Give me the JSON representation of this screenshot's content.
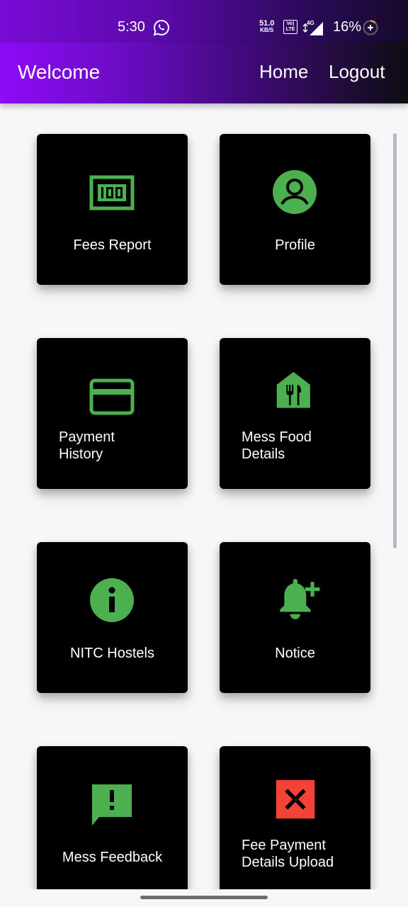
{
  "status_bar": {
    "time": "5:30",
    "speed_value": "51.0",
    "speed_unit": "KB/S",
    "volte_top": "Vo)",
    "volte_bottom": "LTE",
    "network_type": "4G",
    "battery": "16%",
    "icons": [
      "whatsapp-icon",
      "volte-icon",
      "signal-icon",
      "battery-saver-icon"
    ]
  },
  "app_bar": {
    "title": "Welcome",
    "home_label": "Home",
    "logout_label": "Logout",
    "gradient_colors": [
      "#8e0bf7",
      "#0d0d12"
    ]
  },
  "theme": {
    "card_bg": "#000000",
    "icon_green": "#4caf50",
    "icon_red": "#f44336",
    "page_bg": "#f7f7f9"
  },
  "cards": [
    {
      "label": "Fees Report",
      "icon": "money-icon"
    },
    {
      "label": "Profile",
      "icon": "account-circle-icon"
    },
    {
      "label": "Payment History",
      "icon": "credit-card-icon"
    },
    {
      "label": "Mess Food Details",
      "icon": "restaurant-house-icon"
    },
    {
      "label": "NITC Hostels",
      "icon": "info-icon"
    },
    {
      "label": "Notice",
      "icon": "notification-add-icon"
    },
    {
      "label": "Mess Feedback",
      "icon": "feedback-icon"
    },
    {
      "label": "Fee Payment Details Upload",
      "icon": "close-box-icon"
    }
  ]
}
